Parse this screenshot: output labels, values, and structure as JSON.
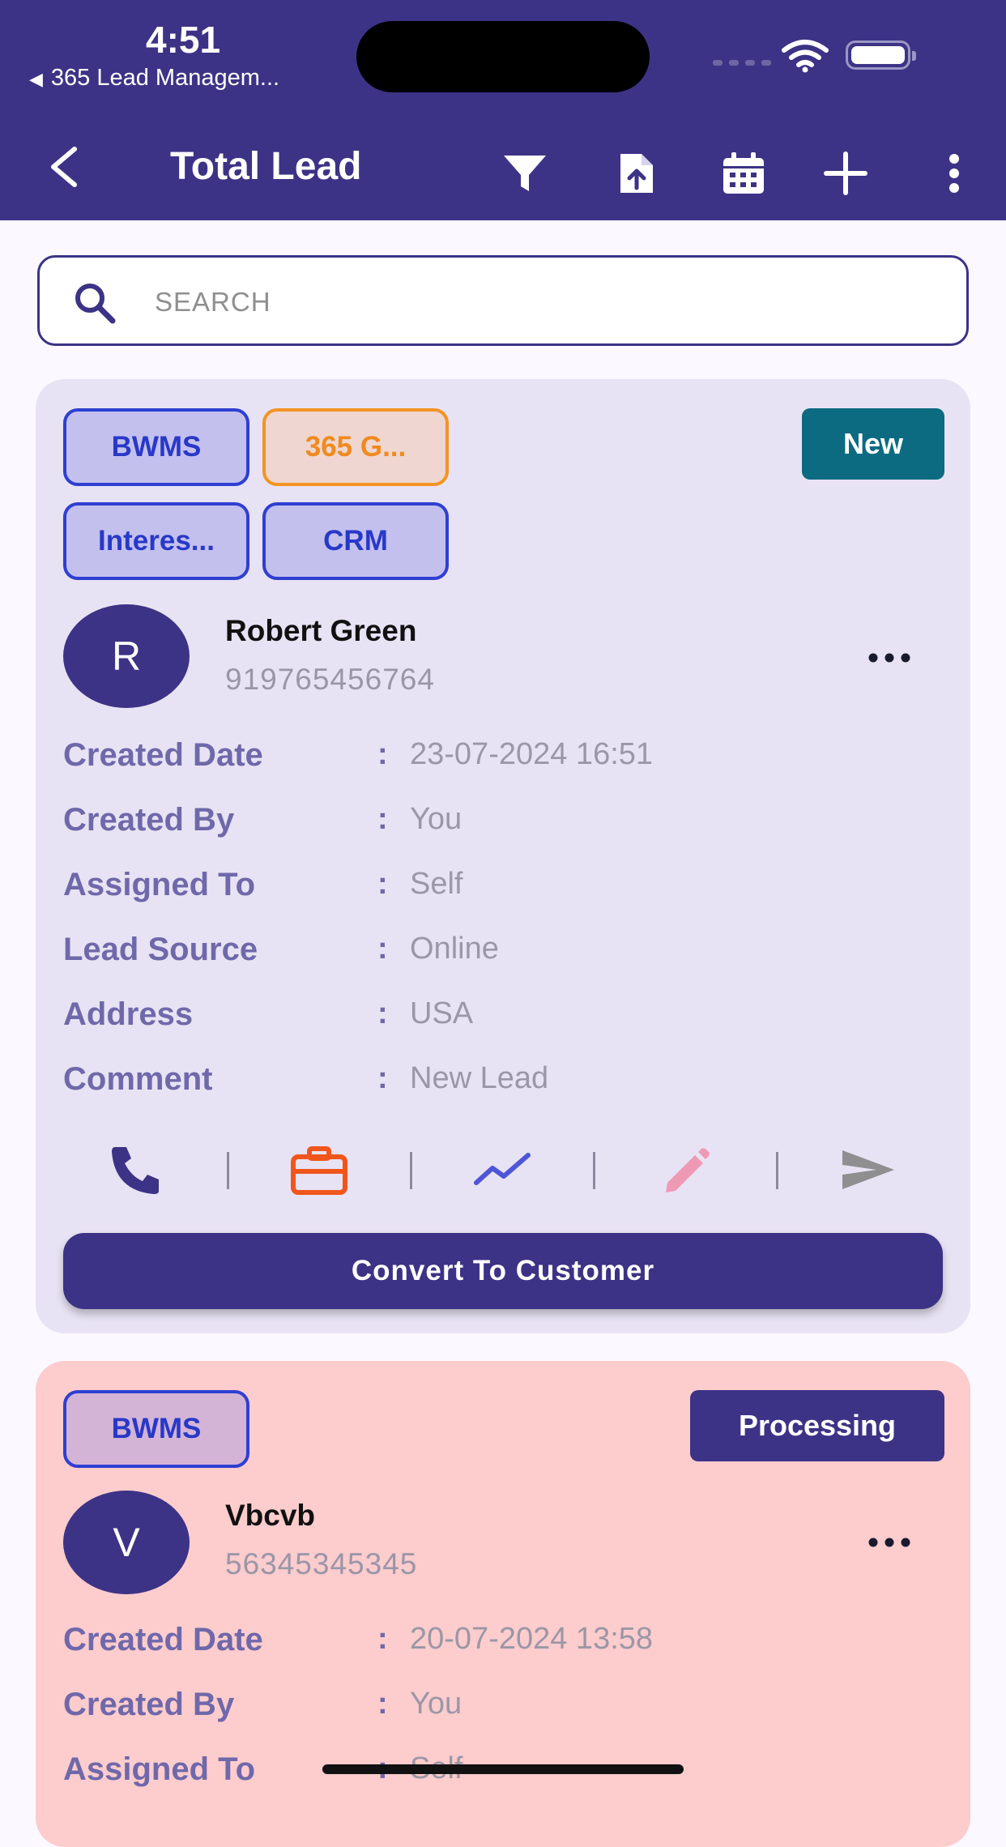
{
  "status_bar": {
    "time": "4:51",
    "back_app": "365 Lead Managem..."
  },
  "app_bar": {
    "title": "Total Lead",
    "icons": [
      "back-icon",
      "filter-icon",
      "file-upload-icon",
      "calendar-icon",
      "add-icon",
      "more-vertical-icon"
    ]
  },
  "search": {
    "placeholder": "SEARCH"
  },
  "leads": [
    {
      "tags": [
        "BWMS",
        "365 G...",
        "Interes...",
        "CRM"
      ],
      "status": "New",
      "status_color": "#0c6b80",
      "avatar_letter": "R",
      "name": "Robert Green",
      "phone": "919765456764",
      "fields": [
        {
          "label": "Created Date",
          "value": "23-07-2024 16:51"
        },
        {
          "label": "Created By",
          "value": "You"
        },
        {
          "label": "Assigned To",
          "value": "Self"
        },
        {
          "label": "Lead Source",
          "value": "Online"
        },
        {
          "label": "Address",
          "value": "USA"
        },
        {
          "label": "Comment",
          "value": "New Lead"
        }
      ],
      "action_icons": [
        "phone-icon",
        "briefcase-icon",
        "trend-icon",
        "edit-icon",
        "send-icon"
      ],
      "convert_label": "Convert To Customer",
      "card_color": "#e8e3f4"
    },
    {
      "tags": [
        "BWMS"
      ],
      "status": "Processing",
      "status_color": "#3c3386",
      "avatar_letter": "V",
      "name": "Vbcvb",
      "phone": "56345345345",
      "fields": [
        {
          "label": "Created Date",
          "value": "20-07-2024 13:58"
        },
        {
          "label": "Created By",
          "value": "You"
        },
        {
          "label": "Assigned To",
          "value": "Self"
        }
      ],
      "card_color": "#fdcccd"
    }
  ],
  "colors": {
    "primary": "#3c3386",
    "chip_blue": "#2f3fd2",
    "chip_orange": "#f39424",
    "label": "#6f68aa",
    "value": "#9b97a6",
    "briefcase": "#f0561c",
    "trend": "#4f56d6",
    "edit": "#ef9ab4",
    "send": "#8f8f8f"
  }
}
